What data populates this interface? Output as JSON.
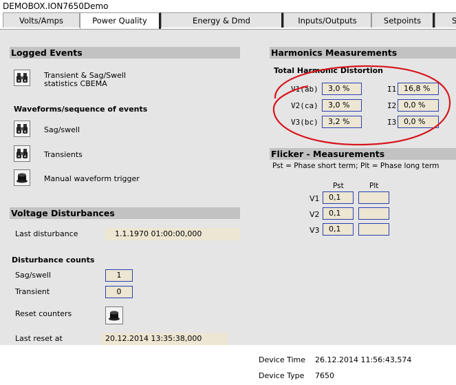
{
  "window": {
    "title": "DEMOBOX.ION7650Demo"
  },
  "tabs": [
    {
      "label": "Volts/Amps"
    },
    {
      "label": "Power Quality"
    },
    {
      "label": "Energy & Dmd"
    },
    {
      "label": "Inputs/Outputs"
    },
    {
      "label": "Setpoints"
    },
    {
      "label": "S"
    }
  ],
  "logged_events": {
    "title": "Logged Events",
    "transient_stats_label_line1": "Transient & Sag/Swell",
    "transient_stats_label_line2": "statistics CBEMA",
    "waveforms_title": "Waveforms/sequence of events",
    "sag_swell_label": "Sag/swell",
    "transients_label": "Transients",
    "manual_trigger_label": "Manual waveform trigger"
  },
  "voltage_disturbances": {
    "title": "Voltage Disturbances",
    "last_disturbance_label": "Last disturbance",
    "last_disturbance_value": "1.1.1970 01:00:00,000",
    "counts_title": "Disturbance counts",
    "sag_swell_label": "Sag/swell",
    "sag_swell_value": "1",
    "transient_label": "Transient",
    "transient_value": "0",
    "reset_counters_label": "Reset counters",
    "last_reset_label": "Last reset at",
    "last_reset_value": "20.12.2014 13:35:38,000"
  },
  "harmonics": {
    "title": "Harmonics Measurements",
    "thd_title": "Total Harmonic Distortion",
    "rows": [
      {
        "v_label": "V1(ab)",
        "v_value": "3,0 %",
        "i_label": "I1",
        "i_value": "16,8 %"
      },
      {
        "v_label": "V2(ca)",
        "v_value": "3,0 %",
        "i_label": "I2",
        "i_value": "0,0 %"
      },
      {
        "v_label": "V3(bc)",
        "v_value": "3,2 %",
        "i_label": "I3",
        "i_value": "0,0 %"
      }
    ],
    "highlight_color": "#d8141c"
  },
  "flicker": {
    "title": "Flicker - Measurements",
    "note": "Pst = Phase short term; Plt = Phase long term",
    "col_pst": "Pst",
    "col_plt": "Plt",
    "rows": [
      {
        "label": "V1",
        "pst": "0,1",
        "plt": ""
      },
      {
        "label": "V2",
        "pst": "0,1",
        "plt": ""
      },
      {
        "label": "V3",
        "pst": "0,1",
        "plt": ""
      }
    ]
  },
  "footer": {
    "device_time_label": "Device Time",
    "device_time_value": "26.12.2014 11:56:43,574",
    "device_type_label": "Device Type",
    "device_type_value": "7650"
  }
}
